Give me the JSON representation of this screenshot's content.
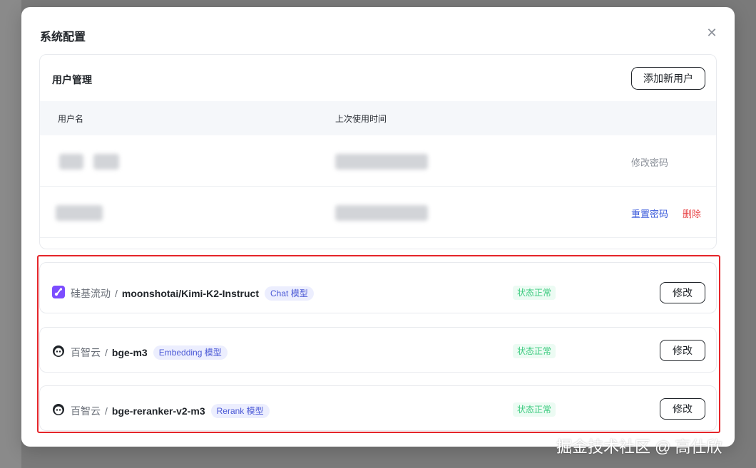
{
  "modal": {
    "title": "系统配置",
    "close_icon": "close-icon"
  },
  "user_management": {
    "title": "用户管理",
    "add_user_label": "添加新用户",
    "columns": [
      "用户名",
      "上次使用时间"
    ],
    "rows": [
      {
        "username": "",
        "last_used": "",
        "actions": [
          "修改密码"
        ]
      },
      {
        "username": "",
        "last_used": "",
        "actions": [
          "重置密码",
          "删除"
        ]
      }
    ]
  },
  "models": [
    {
      "provider_icon": "siliconflow-logo-icon",
      "provider": "硅基流动",
      "name": "moonshotai/Kimi-K2-Instruct",
      "type": "Chat 模型",
      "status": "状态正常",
      "edit_label": "修改"
    },
    {
      "provider_icon": "baidu-cloud-logo-icon",
      "provider": "百智云",
      "name": "bge-m3",
      "type": "Embedding 模型",
      "status": "状态正常",
      "edit_label": "修改"
    },
    {
      "provider_icon": "baidu-cloud-logo-icon",
      "provider": "百智云",
      "name": "bge-reranker-v2-m3",
      "type": "Rerank 模型",
      "status": "状态正常",
      "edit_label": "修改"
    }
  ],
  "colors": {
    "highlight": "#e5252a",
    "status_green": "#3ccb7f",
    "badge_blue": "#4b59d6",
    "link_blue": "#3b5bdb",
    "danger_red": "#e8474a"
  },
  "watermark": "掘金技术社区 @ 高仕欣"
}
